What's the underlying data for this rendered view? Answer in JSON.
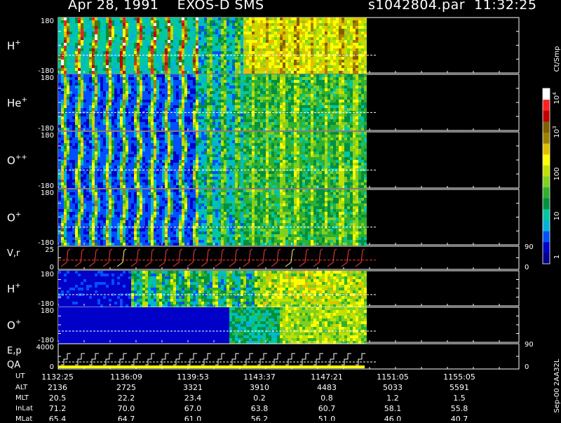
{
  "header": {
    "left": "Apr 28, 1991    EXOS-D SMS",
    "right": "s1042804.par  11:32:25"
  },
  "colorbar": {
    "title": "Ct/Smp",
    "labels": [
      "10^4",
      "10^3",
      "100",
      "10",
      "1"
    ]
  },
  "footer_id": "Sep-00  2AA32L",
  "chart_data": {
    "type": "heatmap",
    "panels": [
      {
        "label": "H+",
        "ymin": "-180",
        "ymax": "180",
        "kind": "spin"
      },
      {
        "label": "He+",
        "ymin": "-180",
        "ymax": "180",
        "kind": "spin"
      },
      {
        "label": "O++",
        "ymin": "-180",
        "ymax": "180",
        "kind": "spin"
      },
      {
        "label": "O+",
        "ymin": "-180",
        "ymax": "180",
        "kind": "spin"
      },
      {
        "label": "V,r",
        "ymin": "0",
        "ymax": "25",
        "right_top": "90",
        "right_bottom": "0",
        "kind": "line"
      },
      {
        "label": "H+",
        "ymin": "-180",
        "ymax": "180",
        "kind": "flat"
      },
      {
        "label": "O+",
        "ymin": "-180",
        "ymax": "180",
        "kind": "flat"
      },
      {
        "label": "E,p",
        "label2": "QA",
        "ymin": "0",
        "ymax": "4000",
        "right_top": "90",
        "right_bottom": "0",
        "kind": "energy"
      }
    ],
    "ephemeris": {
      "rows": [
        {
          "name": "UT",
          "values": [
            "1132:25",
            "1136:09",
            "1139:53",
            "1143:37",
            "1147:21",
            "1151:05",
            "1155:05"
          ]
        },
        {
          "name": "ALT",
          "values": [
            "2136",
            "2725",
            "3321",
            "3910",
            "4483",
            "5033",
            "5591"
          ]
        },
        {
          "name": "MLT",
          "values": [
            "20.5",
            "22.2",
            "23.4",
            "0.2",
            "0.8",
            "1.2",
            "1.5"
          ]
        },
        {
          "name": "InLat",
          "values": [
            "71.2",
            "70.0",
            "67.0",
            "63.8",
            "60.7",
            "58.1",
            "55.8"
          ]
        },
        {
          "name": "MLat",
          "values": [
            "65.4",
            "64.7",
            "61.0",
            "56.2",
            "51.0",
            "46.0",
            "40.7"
          ]
        }
      ]
    }
  }
}
